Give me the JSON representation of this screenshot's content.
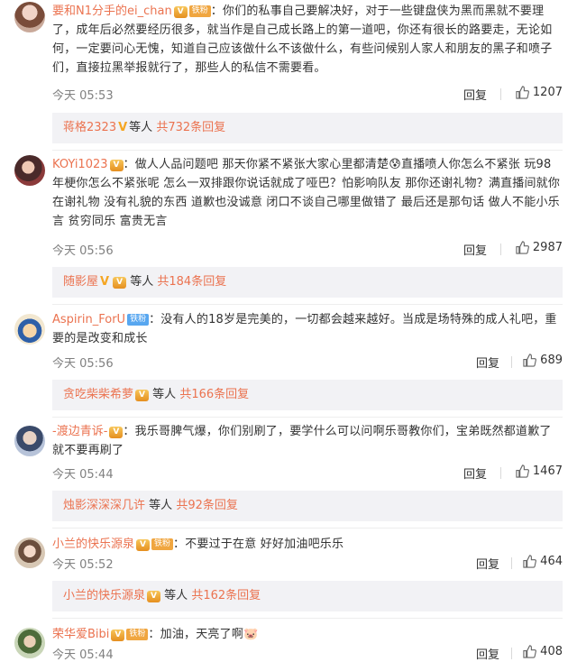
{
  "colors": {
    "username": "#eb7350",
    "subbar_bg": "#f2f2f5",
    "meta": "#808080"
  },
  "icons": {
    "like": "thumbs-up-icon",
    "vip": "crown-vip-icon",
    "verified": "v-verified-icon"
  },
  "comments": [
    {
      "username": "要和N1分手的ei_chan",
      "badge": "铁粉",
      "text": "：你们的私事自己要解决好，对于一些键盘侠为黑而黑就不要理了，成年后必然要经历很多，就当作是自己成长路上的第一道吧，你还有很长的路要走，无论如何，一定要问心无愧，知道自己应该做什么不该做什么，有些问候别人家人和朋友的黑子和喷子们，直接拉黑举报就行了，那些人的私信不需要看。",
      "time": "今天 05:53",
      "reply_label": "回复",
      "likes": "1207",
      "sub": {
        "who": "蒋格2323",
        "mid": "等人",
        "more": "共732条回复"
      }
    },
    {
      "username": "KOYi1023",
      "text": "：做人人品问题吧 那天你紧不紧张大家心里都清楚😰直播喷人你怎么不紧张 玩98年梗你怎么不紧张呢 怎么一双排跟你说话就成了哑巴？怕影响队友 那你还谢礼物？满直播间就你在谢礼物 没有礼貌的东西 道歉也没诚意 闭口不谈自己哪里做错了 最后还是那句话 做人不能小乐言 贫穷同乐 富贵无言",
      "time": "今天 05:56",
      "reply_label": "回复",
      "likes": "2987",
      "sub": {
        "who": "随影屋",
        "mid": "等人",
        "more": "共184条回复"
      }
    },
    {
      "username": "Aspirin_ForU",
      "badge": "铁粉",
      "text": "：没有人的18岁是完美的，一切都会越来越好。当成是场特殊的成人礼吧，重要的是改变和成长",
      "time": "今天 05:56",
      "reply_label": "回复",
      "likes": "689",
      "sub": {
        "who": "贪吃柴柴希萝",
        "mid": "等人",
        "more": "共166条回复"
      }
    },
    {
      "username": "-渡边青诉-",
      "text": "：我乐哥脾气爆，你们别刷了，要学什么可以问啊乐哥教你们，宝弟既然都道歉了就不要再刷了",
      "time": "今天 05:44",
      "reply_label": "回复",
      "likes": "1467",
      "sub": {
        "who": "烛影深深深几许",
        "mid": "等人",
        "more": "共92条回复"
      }
    },
    {
      "username": "小兰的快乐源泉",
      "badge": "铁粉",
      "text": "：不要过于在意 好好加油吧乐乐",
      "time": "今天 05:52",
      "reply_label": "回复",
      "likes": "464",
      "sub": {
        "who": "小兰的快乐源泉",
        "mid": "等人",
        "more": "共162条回复"
      }
    },
    {
      "username": "荣华爱Bibi",
      "badge": "铁粉",
      "text": "：加油，天亮了啊🐷",
      "time": "今天 05:44",
      "reply_label": "回复",
      "likes": "408"
    }
  ]
}
